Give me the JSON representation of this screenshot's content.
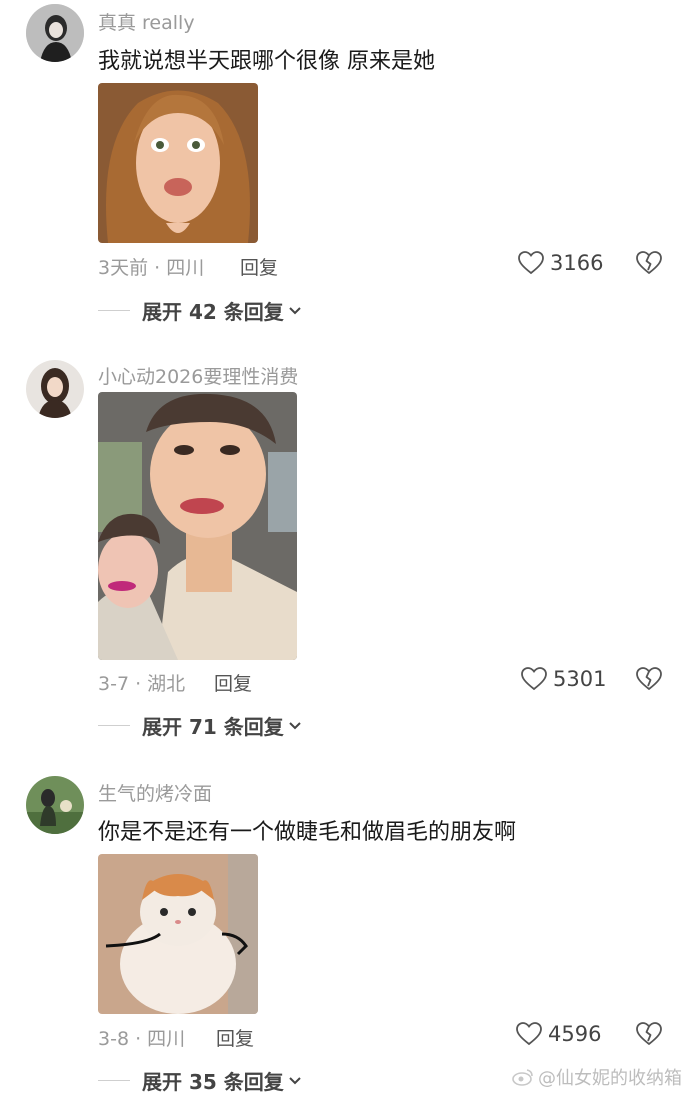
{
  "comments": [
    {
      "username": "真真 really",
      "text": "我就说想半天跟哪个很像 原来是她",
      "meta": "3天前 · 四川",
      "reply_label": "回复",
      "likes": "3166",
      "expand_label": "展开 42 条回复"
    },
    {
      "username": "小心动2026要理性消费",
      "text": "",
      "meta": "3-7 · 湖北",
      "reply_label": "回复",
      "likes": "5301",
      "expand_label": "展开 71 条回复"
    },
    {
      "username": "生气的烤冷面",
      "text": "你是不是还有一个做睫毛和做眉毛的朋友啊",
      "meta": "3-8 · 四川",
      "reply_label": "回复",
      "likes": "4596",
      "expand_label": "展开 35 条回复"
    }
  ],
  "watermark": "@仙女妮的收纳箱",
  "icons": {
    "like": "heart-outline-icon",
    "dislike": "broken-heart-icon",
    "expand": "chevron-down-icon"
  },
  "colors": {
    "muted": "#9a9a9a",
    "text": "#1a1a1a"
  }
}
